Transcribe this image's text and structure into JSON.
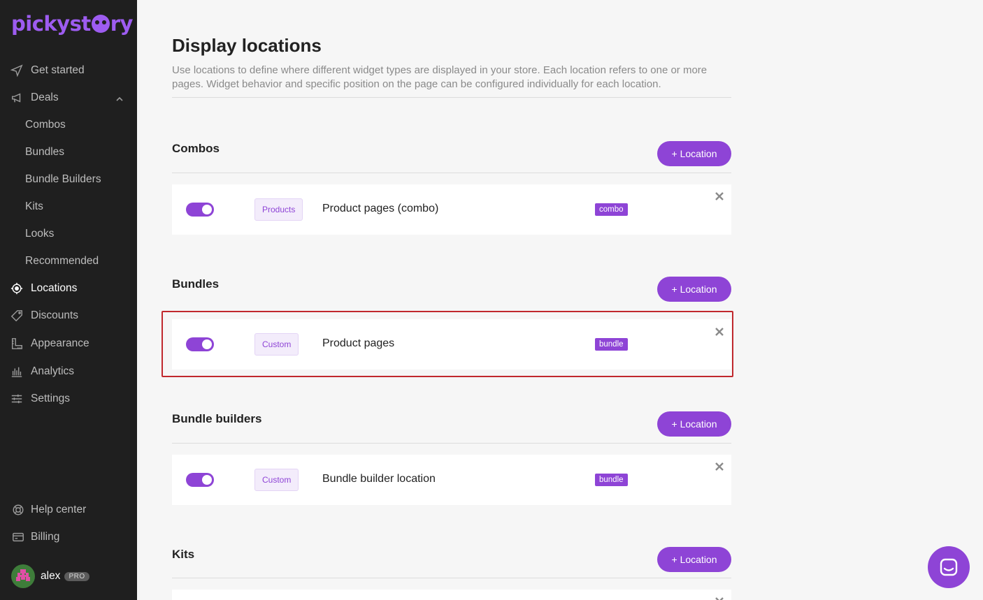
{
  "brand": {
    "logo_left": "pickyst",
    "logo_right": "ry",
    "accent": "#8e44d6"
  },
  "sidebar": {
    "items": [
      {
        "label": "Get started",
        "icon": "send-icon"
      },
      {
        "label": "Deals",
        "icon": "megaphone-icon"
      },
      {
        "label": "Locations",
        "icon": "location-target-icon"
      },
      {
        "label": "Discounts",
        "icon": "tag-icon"
      },
      {
        "label": "Appearance",
        "icon": "ruler-icon"
      },
      {
        "label": "Analytics",
        "icon": "bar-chart-icon"
      },
      {
        "label": "Settings",
        "icon": "sliders-icon"
      }
    ],
    "deals_sub": [
      "Combos",
      "Bundles",
      "Bundle Builders",
      "Kits",
      "Looks",
      "Recommended"
    ],
    "footer": [
      {
        "label": "Help center",
        "icon": "lifebuoy-icon"
      },
      {
        "label": "Billing",
        "icon": "credit-card-icon"
      }
    ],
    "user": {
      "name": "alex",
      "plan": "PRO"
    }
  },
  "page": {
    "title": "Display locations",
    "description": "Use locations to define where different widget types are displayed in your store. Each location refers to one or more pages. Widget behavior and specific position on the page can be configured individually for each location."
  },
  "sections": [
    {
      "title": "Combos",
      "button": "+ Location",
      "rows": [
        {
          "enabled": true,
          "type": "Products",
          "name": "Product pages (combo)",
          "tag": "combo"
        }
      ]
    },
    {
      "title": "Bundles",
      "button": "+ Location",
      "rows": [
        {
          "enabled": true,
          "type": "Custom",
          "name": "Product pages",
          "tag": "bundle"
        }
      ]
    },
    {
      "title": "Bundle builders",
      "button": "+ Location",
      "rows": [
        {
          "enabled": true,
          "type": "Custom",
          "name": "Bundle builder location",
          "tag": "bundle"
        }
      ]
    },
    {
      "title": "Kits",
      "button": "+ Location"
    }
  ]
}
